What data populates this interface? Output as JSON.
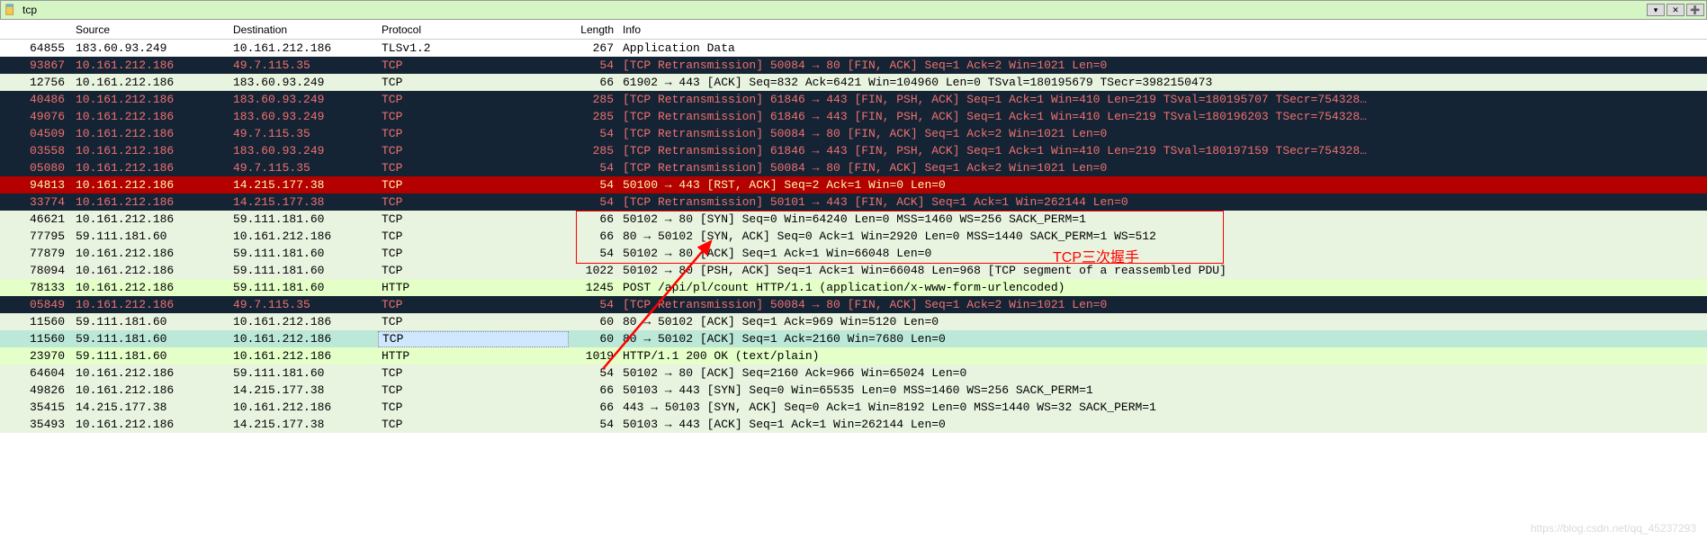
{
  "filter": {
    "text": "tcp"
  },
  "columns": {
    "no": "",
    "source": "Source",
    "destination": "Destination",
    "protocol": "Protocol",
    "length": "Length",
    "info": "Info"
  },
  "rows": [
    {
      "no": "64855",
      "src": "183.60.93.249",
      "dst": "10.161.212.186",
      "proto": "TLSv1.2",
      "len": "267",
      "info": "Application Data",
      "cls": "bg-tls"
    },
    {
      "no": "93867",
      "src": "10.161.212.186",
      "dst": "49.7.115.35",
      "proto": "TCP",
      "len": "54",
      "info": "[TCP Retransmission] 50084 → 80 [FIN, ACK] Seq=1 Ack=2 Win=1021 Len=0",
      "cls": "bg-retrans"
    },
    {
      "no": "12756",
      "src": "10.161.212.186",
      "dst": "183.60.93.249",
      "proto": "TCP",
      "len": "66",
      "info": "61902 → 443 [ACK] Seq=832 Ack=6421 Win=104960 Len=0 TSval=180195679 TSecr=3982150473",
      "cls": "bg-tcpack"
    },
    {
      "no": "40486",
      "src": "10.161.212.186",
      "dst": "183.60.93.249",
      "proto": "TCP",
      "len": "285",
      "info": "[TCP Retransmission] 61846 → 443 [FIN, PSH, ACK] Seq=1 Ack=1 Win=410 Len=219 TSval=180195707 TSecr=754328…",
      "cls": "bg-retrans"
    },
    {
      "no": "49076",
      "src": "10.161.212.186",
      "dst": "183.60.93.249",
      "proto": "TCP",
      "len": "285",
      "info": "[TCP Retransmission] 61846 → 443 [FIN, PSH, ACK] Seq=1 Ack=1 Win=410 Len=219 TSval=180196203 TSecr=754328…",
      "cls": "bg-retrans"
    },
    {
      "no": "04509",
      "src": "10.161.212.186",
      "dst": "49.7.115.35",
      "proto": "TCP",
      "len": "54",
      "info": "[TCP Retransmission] 50084 → 80 [FIN, ACK] Seq=1 Ack=2 Win=1021 Len=0",
      "cls": "bg-retrans"
    },
    {
      "no": "03558",
      "src": "10.161.212.186",
      "dst": "183.60.93.249",
      "proto": "TCP",
      "len": "285",
      "info": "[TCP Retransmission] 61846 → 443 [FIN, PSH, ACK] Seq=1 Ack=1 Win=410 Len=219 TSval=180197159 TSecr=754328…",
      "cls": "bg-retrans"
    },
    {
      "no": "05080",
      "src": "10.161.212.186",
      "dst": "49.7.115.35",
      "proto": "TCP",
      "len": "54",
      "info": "[TCP Retransmission] 50084 → 80 [FIN, ACK] Seq=1 Ack=2 Win=1021 Len=0",
      "cls": "bg-retrans"
    },
    {
      "no": "94813",
      "src": "10.161.212.186",
      "dst": "14.215.177.38",
      "proto": "TCP",
      "len": "54",
      "info": "50100 → 443 [RST, ACK] Seq=2 Ack=1 Win=0 Len=0",
      "cls": "bg-selected"
    },
    {
      "no": "33774",
      "src": "10.161.212.186",
      "dst": "14.215.177.38",
      "proto": "TCP",
      "len": "54",
      "info": "[TCP Retransmission] 50101 → 443 [FIN, ACK] Seq=1 Ack=1 Win=262144 Len=0",
      "cls": "bg-retrans"
    },
    {
      "no": "46621",
      "src": "10.161.212.186",
      "dst": "59.111.181.60",
      "proto": "TCP",
      "len": "66",
      "info": "50102 → 80 [SYN] Seq=0 Win=64240 Len=0 MSS=1460 WS=256 SACK_PERM=1",
      "cls": "bg-tcpsyn"
    },
    {
      "no": "77795",
      "src": "59.111.181.60",
      "dst": "10.161.212.186",
      "proto": "TCP",
      "len": "66",
      "info": "80 → 50102 [SYN, ACK] Seq=0 Ack=1 Win=2920 Len=0 MSS=1440 SACK_PERM=1 WS=512",
      "cls": "bg-tcpsyn"
    },
    {
      "no": "77879",
      "src": "10.161.212.186",
      "dst": "59.111.181.60",
      "proto": "TCP",
      "len": "54",
      "info": "50102 → 80 [ACK] Seq=1 Ack=1 Win=66048 Len=0",
      "cls": "bg-tcpack"
    },
    {
      "no": "78094",
      "src": "10.161.212.186",
      "dst": "59.111.181.60",
      "proto": "TCP",
      "len": "1022",
      "info": "50102 → 80 [PSH, ACK] Seq=1 Ack=1 Win=66048 Len=968 [TCP segment of a reassembled PDU]",
      "cls": "bg-tcpack"
    },
    {
      "no": "78133",
      "src": "10.161.212.186",
      "dst": "59.111.181.60",
      "proto": "HTTP",
      "len": "1245",
      "info": "POST /api/pl/count HTTP/1.1  (application/x-www-form-urlencoded)",
      "cls": "bg-http"
    },
    {
      "no": "05849",
      "src": "10.161.212.186",
      "dst": "49.7.115.35",
      "proto": "TCP",
      "len": "54",
      "info": "[TCP Retransmission] 50084 → 80 [FIN, ACK] Seq=1 Ack=2 Win=1021 Len=0",
      "cls": "bg-retrans"
    },
    {
      "no": "11560",
      "src": "59.111.181.60",
      "dst": "10.161.212.186",
      "proto": "TCP",
      "len": "60",
      "info": "80 → 50102 [ACK] Seq=1 Ack=969 Win=5120 Len=0",
      "cls": "bg-tcpack"
    },
    {
      "no": "11560",
      "src": "59.111.181.60",
      "dst": "10.161.212.186",
      "proto": "TCP",
      "len": "60",
      "info": "80 → 50102 [ACK] Seq=1 Ack=2160 Win=7680 Len=0",
      "cls": "bg-sel2",
      "focus": true
    },
    {
      "no": "23970",
      "src": "59.111.181.60",
      "dst": "10.161.212.186",
      "proto": "HTTP",
      "len": "1019",
      "info": "HTTP/1.1 200 OK  (text/plain)",
      "cls": "bg-http"
    },
    {
      "no": "64604",
      "src": "10.161.212.186",
      "dst": "59.111.181.60",
      "proto": "TCP",
      "len": "54",
      "info": "50102 → 80 [ACK] Seq=2160 Ack=966 Win=65024 Len=0",
      "cls": "bg-tcpack"
    },
    {
      "no": "49826",
      "src": "10.161.212.186",
      "dst": "14.215.177.38",
      "proto": "TCP",
      "len": "66",
      "info": "50103 → 443 [SYN] Seq=0 Win=65535 Len=0 MSS=1460 WS=256 SACK_PERM=1",
      "cls": "bg-tcpsyn"
    },
    {
      "no": "35415",
      "src": "14.215.177.38",
      "dst": "10.161.212.186",
      "proto": "TCP",
      "len": "66",
      "info": "443 → 50103 [SYN, ACK] Seq=0 Ack=1 Win=8192 Len=0 MSS=1440 WS=32 SACK_PERM=1",
      "cls": "bg-tcpsyn"
    },
    {
      "no": "35493",
      "src": "10.161.212.186",
      "dst": "14.215.177.38",
      "proto": "TCP",
      "len": "54",
      "info": "50103 → 443 [ACK] Seq=1 Ack=1 Win=262144 Len=0",
      "cls": "bg-tcpack"
    }
  ],
  "annotation": {
    "label": "TCP三次握手"
  },
  "watermark": "https://blog.csdn.net/qq_45237293"
}
